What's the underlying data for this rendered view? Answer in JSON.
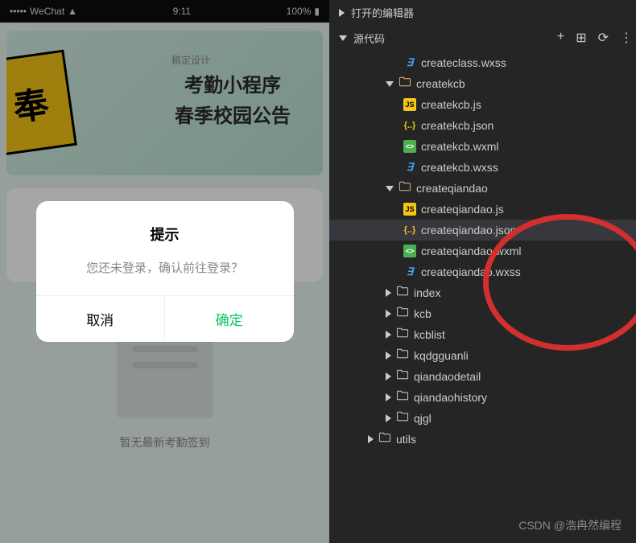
{
  "phone": {
    "status": {
      "carrier": "WeChat",
      "signal": "•••••",
      "time": "9:11",
      "battery": "100%"
    },
    "banner": {
      "badge": "奉",
      "sub": "稿定设计",
      "line1": "考勤小程序",
      "line2": "春季校园公告"
    },
    "placeholder_text": "暂无最新考勤签到",
    "modal": {
      "title": "提示",
      "message": "您还未登录，确认前往登录？",
      "cancel": "取消",
      "confirm": "确定"
    }
  },
  "editor": {
    "panels": {
      "editors": "打开的编辑器",
      "source": "源代码"
    },
    "tree": {
      "file_wxss_top": "createclass.wxss",
      "folder_createkcb": "createkcb",
      "kcb": {
        "js": "createkcb.js",
        "json": "createkcb.json",
        "wxml": "createkcb.wxml",
        "wxss": "createkcb.wxss"
      },
      "folder_createqiandao": "createqiandao",
      "qd": {
        "js": "createqiandao.js",
        "json": "createqiandao.json",
        "wxml": "createqiandao.wxml",
        "wxss": "createqiandao.wxss"
      },
      "folders": {
        "index": "index",
        "kcb": "kcb",
        "kcblist": "kcblist",
        "kqdgguanli": "kqdgguanli",
        "qiandaodetail": "qiandaodetail",
        "qiandaohistory": "qiandaohistory",
        "qjgl": "qjgl",
        "utils": "utils"
      }
    }
  },
  "watermark": "CSDN @浩冉然编程"
}
